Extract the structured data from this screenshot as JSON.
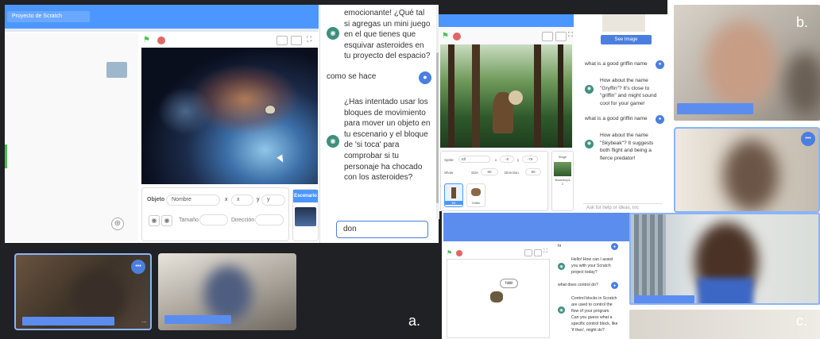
{
  "panel_a": {
    "label": "a.",
    "project_title": "Proyecto de Scratch",
    "chat": {
      "bot_message_1": "emocionante! ¿Qué tal si agregas un mini juego en el que tienes que esquivar asteroides en tu proyecto del espacio?",
      "user_message_1": "como se hace",
      "bot_message_2": "¿Has intentado usar los bloques de movimiento para mover un objeto en tu escenario y el bloque de 'si toca' para comprobar si tu personaje ha chocado con los asteroides?",
      "input_value": "don"
    },
    "sprite_info": {
      "object_label": "Objeto",
      "name_placeholder": "Nombre",
      "x_label": "x",
      "x_value": "x",
      "y_label": "y",
      "y_value": "y",
      "size_label": "Tamaño",
      "direction_label": "Dirección",
      "stage_label": "Escenario"
    },
    "participant_tile_dots": "•••",
    "participant_more": "..."
  },
  "panel_b": {
    "label": "b.",
    "see_image_button": "See Image",
    "sprite_info": {
      "sprite_label": "Sprite",
      "sprite_name": "Elf",
      "x_label": "x",
      "x_value": "-9",
      "y_label": "y",
      "y_value": "-79",
      "show_label": "Show",
      "size_label": "Size",
      "size_value": "80",
      "direction_label": "Direction",
      "direction_value": "90",
      "stage_label": "Stage",
      "backdrops_label": "Backdrops",
      "backdrops_count": "2"
    },
    "sprites": [
      {
        "name": "Elf"
      },
      {
        "name": "Griffin"
      }
    ],
    "chat": [
      {
        "role": "user",
        "text": "what is a good griffin name"
      },
      {
        "role": "bot",
        "text": "How about the name \"Gryffin\"? It's close to \"griffin\" and might sound cool for your game!"
      },
      {
        "role": "user",
        "text": "what is a good griffin name"
      },
      {
        "role": "bot",
        "text": "How about the name \"Skybeak\"? It suggests both flight and being a fierce predator!"
      }
    ],
    "input_placeholder": "Ask for help or ideas, inc",
    "tile_dots": "•••"
  },
  "panel_c": {
    "label": "c.",
    "speech_bubble": "hiiiiii",
    "chat": [
      {
        "role": "user",
        "text": "hi"
      },
      {
        "role": "bot",
        "text": "Hello! How can I assist you with your Scratch project today?"
      },
      {
        "role": "user",
        "text": "what does control do?"
      },
      {
        "role": "bot",
        "text": "Control blocks in Scratch are used to control the flow of your program. Can you guess what a specific control block, like 'if then', might do?"
      }
    ]
  },
  "icons": {
    "flag": "⚑",
    "user": "●",
    "bot": "◉",
    "zoom": "⊕",
    "fullscreen": "⛶"
  }
}
